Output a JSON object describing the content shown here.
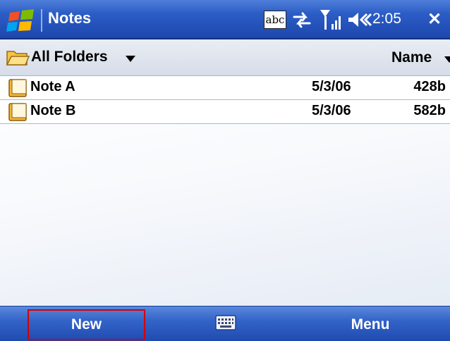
{
  "titlebar": {
    "app_title": "Notes",
    "clock": "2:05",
    "sip_label": "abc",
    "close_glyph": "✕",
    "icons": [
      "windows-start-icon",
      "input-panel-icon",
      "connectivity-icon",
      "signal-icon",
      "volume-icon",
      "close-icon"
    ]
  },
  "header": {
    "folders_label": "All Folders",
    "sort_label": "Name"
  },
  "notes": [
    {
      "name": "Note A",
      "date": "5/3/06",
      "size": "428b"
    },
    {
      "name": "Note B",
      "date": "5/3/06",
      "size": "582b"
    }
  ],
  "softkeys": {
    "left": "New",
    "right": "Menu",
    "left_highlight_color": "#d40000"
  },
  "colors": {
    "titlebar": "#2c5dc6",
    "softbar": "#3464c8",
    "row_divider": "#a9b8cf"
  }
}
